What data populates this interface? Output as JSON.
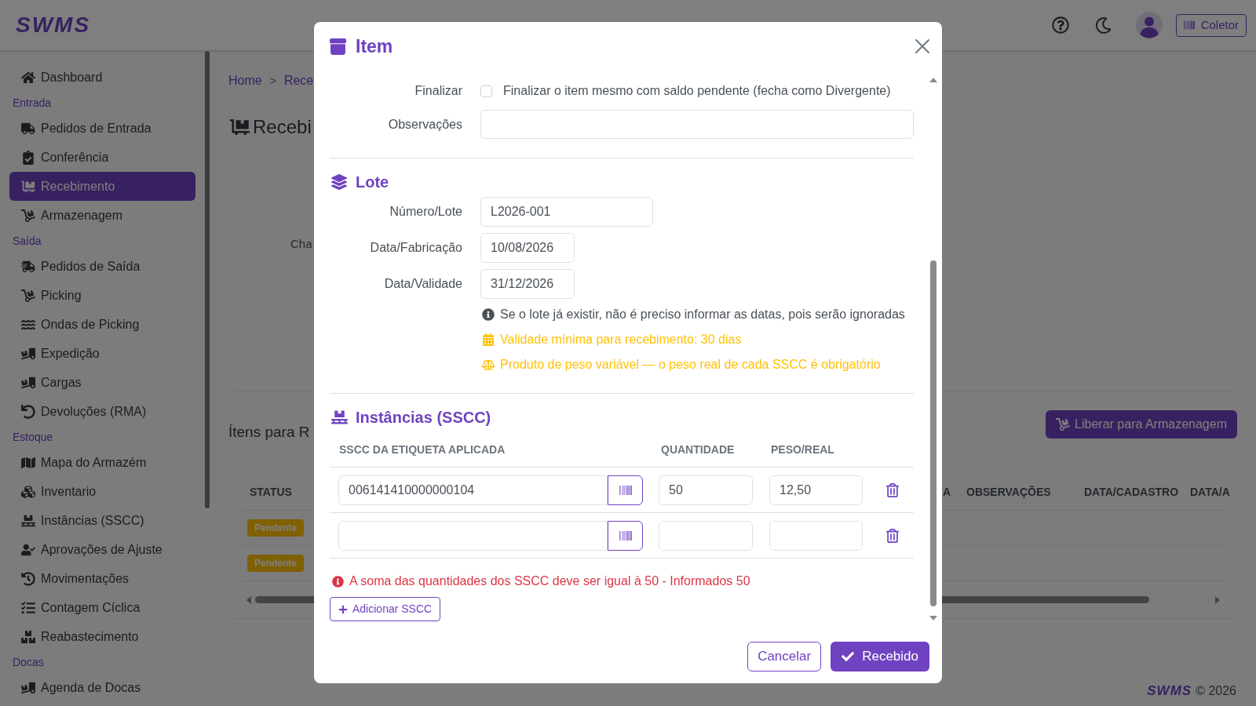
{
  "header": {
    "logo": "SWMS",
    "collector_button": "Coletor"
  },
  "sidebar": {
    "items": [
      {
        "label": "Dashboard",
        "selected": false
      }
    ],
    "sections": [
      {
        "title": "Entrada",
        "items": [
          {
            "label": "Pedidos de Entrada",
            "selected": false
          },
          {
            "label": "Conferência",
            "selected": false
          },
          {
            "label": "Recebimento",
            "selected": true
          },
          {
            "label": "Armazenagem",
            "selected": false
          }
        ]
      },
      {
        "title": "Saída",
        "items": [
          {
            "label": "Pedidos de Saída",
            "selected": false
          },
          {
            "label": "Picking",
            "selected": false
          },
          {
            "label": "Ondas de Picking",
            "selected": false
          },
          {
            "label": "Expedição",
            "selected": false
          },
          {
            "label": "Cargas",
            "selected": false
          },
          {
            "label": "Devoluções (RMA)",
            "selected": false
          }
        ]
      },
      {
        "title": "Estoque",
        "items": [
          {
            "label": "Mapa do Armazém",
            "selected": false
          },
          {
            "label": "Inventario",
            "selected": false
          },
          {
            "label": "Instâncias (SSCC)",
            "selected": false
          },
          {
            "label": "Aprovações de Ajuste",
            "selected": false
          },
          {
            "label": "Movimentações",
            "selected": false
          },
          {
            "label": "Contagem Cíclica",
            "selected": false
          },
          {
            "label": "Reabastecimento",
            "selected": false
          }
        ]
      },
      {
        "title": "Docas",
        "items": [
          {
            "label": "Agenda de Docas",
            "selected": false
          }
        ]
      }
    ]
  },
  "breadcrumb": {
    "items": [
      "Home",
      "Rece"
    ],
    "separator": ">"
  },
  "page": {
    "title": "Recebi",
    "field_label": "Cha",
    "items_title": "Ítens para R",
    "release_button": "Liberar para Armazenagem",
    "table": {
      "columns": [
        "STATUS",
        "A",
        "OBSERVAÇÕES",
        "DATA/CADASTRO",
        "DATA/A"
      ],
      "rows": [
        {
          "status": "Pendente"
        },
        {
          "status": "Pendente"
        }
      ]
    }
  },
  "modal": {
    "title": "Item",
    "form": [
      {
        "kind": "checkbox",
        "label": "Finalizar",
        "text": "Finalizar o item mesmo com saldo pendente (fecha como Divergente)",
        "checked": false
      },
      {
        "kind": "text",
        "label": "Observações"
      }
    ],
    "lot": {
      "title": "Lote",
      "fields": [
        {
          "kind": "text",
          "label": "Número/Lote",
          "value": "L2026-001"
        },
        {
          "kind": "date",
          "label": "Data/Fabricação",
          "value": "10/08/2026"
        },
        {
          "kind": "date",
          "label": "Data/Validade",
          "value": "31/12/2026"
        }
      ],
      "notes": [
        {
          "kind": "info",
          "text": "Se o lote já existir, não é preciso informar as datas, pois serão ignoradas"
        },
        {
          "kind": "validity",
          "text": "Validade mínima para recebimento: 30 dias"
        },
        {
          "kind": "weight",
          "text": "Produto de peso variável — o peso real de cada SSCC é obrigatório"
        }
      ]
    },
    "instances": {
      "title": "Instâncias (SSCC)",
      "columns": [
        "SSCC DA ETIQUETA APLICADA",
        "QUANTIDADE",
        "PESO/REAL"
      ],
      "rows": [
        {
          "sscc": "006141410000000104",
          "quantity": "50",
          "weight": "12,50"
        },
        {}
      ]
    },
    "error": "A soma das quantidades dos SSCC deve ser igual à 50 - Informados 50",
    "add_button": "Adicionar SSCC",
    "buttons": [
      {
        "kind": "secondary",
        "label": "Cancelar"
      },
      {
        "kind": "primary",
        "label": "Recebido"
      }
    ]
  },
  "footer": {
    "logo": "SWMS",
    "copyright": "© 2026"
  }
}
